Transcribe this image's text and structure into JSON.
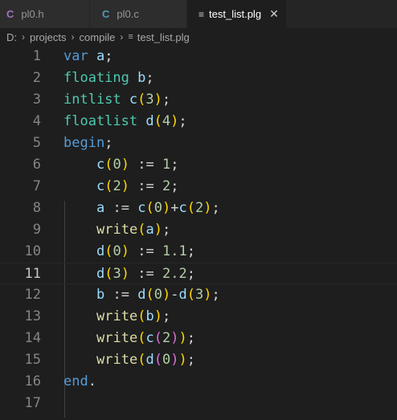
{
  "tabs": [
    {
      "icon": "C",
      "label": "pl0.h",
      "active": false
    },
    {
      "icon": "C",
      "label": "pl0.c",
      "active": false
    },
    {
      "icon": "≡",
      "label": "test_list.plg",
      "active": true,
      "close": "✕"
    }
  ],
  "breadcrumb": {
    "drive": "D:",
    "folder1": "projects",
    "folder2": "compile",
    "file": "test_list.plg",
    "separator": "›"
  },
  "colors": {
    "c_icon": "#a074c4",
    "c_icon_alt": "#519aba",
    "keyword": "#569cd6",
    "type": "#4ec9b0",
    "identifier": "#9cdcfe",
    "function": "#dcdcaa",
    "number": "#b5cea8",
    "bracket1": "#ffd700",
    "bracket2": "#da70d6"
  },
  "editor": {
    "current_line": 11,
    "line_numbers": [
      "1",
      "2",
      "3",
      "4",
      "5",
      "6",
      "7",
      "8",
      "9",
      "10",
      "11",
      "12",
      "13",
      "14",
      "15",
      "16",
      "17"
    ],
    "lines": [
      "var a;",
      "floating b;",
      "intlist c(3);",
      "floatlist d(4);",
      "begin;",
      "    c(0) := 1;",
      "    c(2) := 2;",
      "    a := c(0)+c(2);",
      "    write(a);",
      "    d(0) := 1.1;",
      "    d(3) := 2.2;",
      "    b := d(0)-d(3);",
      "    write(b);",
      "    write(c(2));",
      "    write(d(0));",
      "end.",
      ""
    ]
  }
}
